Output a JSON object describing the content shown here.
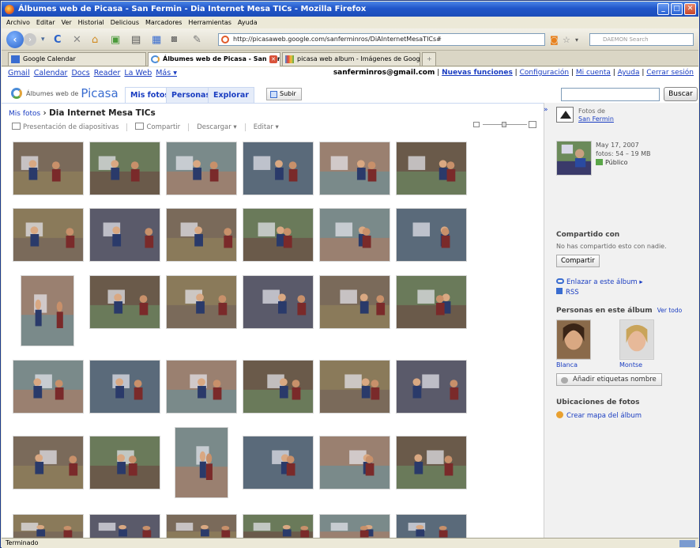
{
  "window": {
    "title": "Álbumes web de Picasa - San Fermin - Dia Internet Mesa TICs - Mozilla Firefox"
  },
  "menu": [
    "Archivo",
    "Editar",
    "Ver",
    "Historial",
    "Delicious",
    "Marcadores",
    "Herramientas",
    "Ayuda"
  ],
  "url": "http://picasaweb.google.com/sanferminros/DiAInternetMesaTICs#",
  "search_placeholder": "DAEMON Search",
  "tabs": [
    {
      "label": "Google Calendar"
    },
    {
      "label": "Álbumes web de Picasa - San Fer..."
    },
    {
      "label": "picasa web album - Imágenes de Google"
    }
  ],
  "gbar": {
    "links": [
      "Gmail",
      "Calendar",
      "Docs",
      "Reader",
      "La Web",
      "Más ▾"
    ],
    "email": "sanferminros@gmail.com",
    "right_links": [
      "Nuevas funciones",
      "Configuración",
      "Mi cuenta",
      "Ayuda",
      "Cerrar sesión"
    ]
  },
  "picasa": {
    "logo_small": "Álbumes web de",
    "logo_big": "Picasa",
    "nav": [
      "Mis fotos",
      "Personas",
      "Explorar"
    ],
    "upload": "Subir",
    "search_button": "Buscar"
  },
  "breadcrumb": {
    "parent": "Mis fotos",
    "sep": " › ",
    "current": "Dia Internet Mesa TICs"
  },
  "actions": [
    "Presentación de diapositivas",
    "Compartir",
    "Descargar ▾",
    "Editar ▾"
  ],
  "sidebar": {
    "collapse": "»",
    "owner_label": "Fotos de",
    "owner_name": "San Fermin",
    "date": "May 17, 2007",
    "stats": "fotos: 54 – 19 MB",
    "visibility": "Público",
    "shared_title": "Compartido con",
    "shared_text": "No has compartido esto con nadie.",
    "share_button": "Compartir",
    "link_album": "Enlazar a este álbum ▸",
    "rss": "RSS",
    "people_title": "Personas en este álbum",
    "see_all": "Ver todo",
    "people": [
      "Blanca",
      "Montse"
    ],
    "tag_button": "Añadir etiquetas nombre",
    "places_title": "Ubicaciones de fotos",
    "map_link": "Crear mapa del álbum"
  },
  "status": "Terminado",
  "colors": {
    "link": "#1a3dc1",
    "title_bar": "#2156c9"
  }
}
